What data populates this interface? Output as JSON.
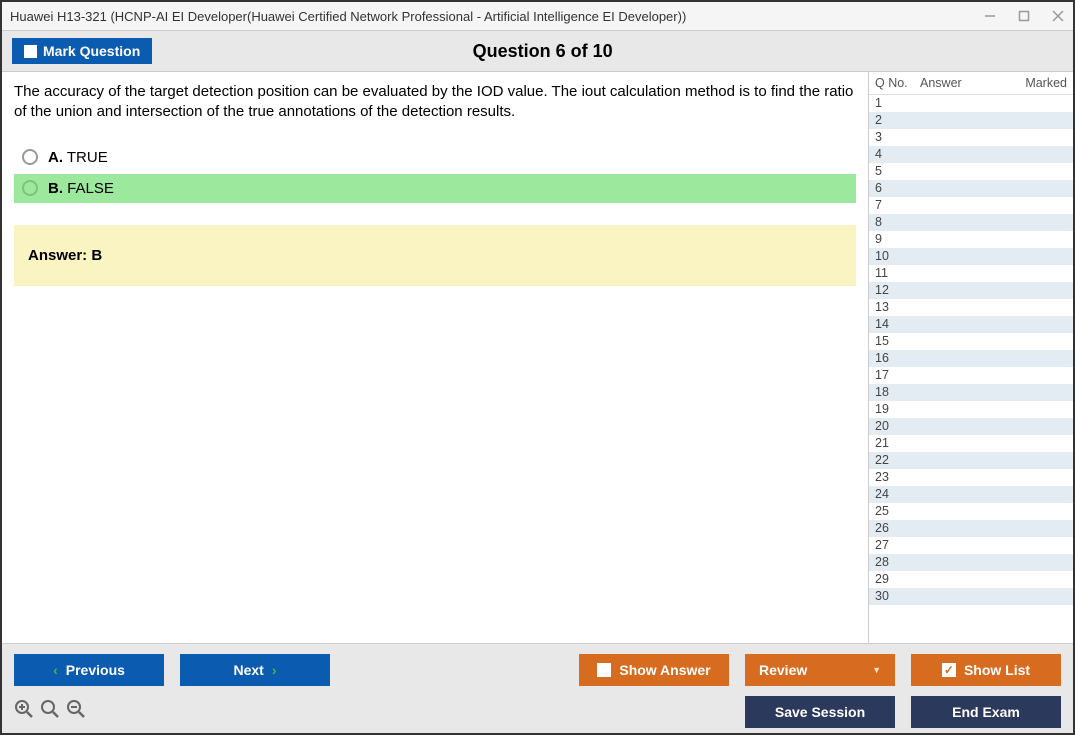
{
  "window": {
    "title": "Huawei H13-321 (HCNP-AI EI Developer(Huawei Certified Network Professional - Artificial Intelligence EI Developer))"
  },
  "header": {
    "mark_label": "Mark Question",
    "question_title": "Question 6 of 10"
  },
  "question": {
    "text": "The accuracy of the target detection position can be evaluated by the IOD value. The iout calculation method is to find the ratio of the union and intersection of the true annotations of the detection results.",
    "options": [
      {
        "letter": "A.",
        "text": "TRUE",
        "correct": false
      },
      {
        "letter": "B.",
        "text": "FALSE",
        "correct": true
      }
    ],
    "answer_label": "Answer: B"
  },
  "sidebar": {
    "headers": {
      "qno": "Q No.",
      "answer": "Answer",
      "marked": "Marked"
    },
    "count": 30
  },
  "footer": {
    "previous": "Previous",
    "next": "Next",
    "show_answer": "Show Answer",
    "review": "Review",
    "show_list": "Show List",
    "save_session": "Save Session",
    "end_exam": "End Exam"
  }
}
